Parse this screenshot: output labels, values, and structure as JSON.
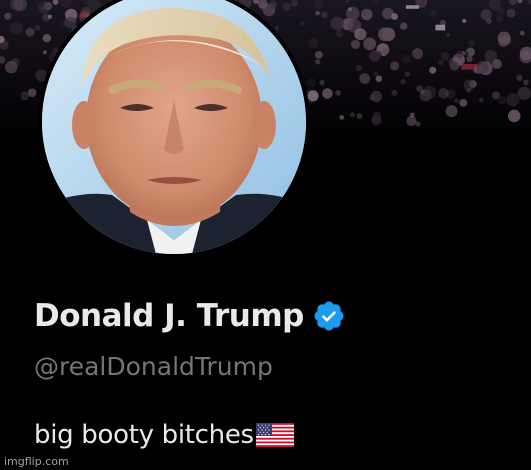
{
  "profile": {
    "display_name": "Donald J. Trump",
    "handle": "@realDonaldTrump",
    "bio": "big booty bitches",
    "verified": true,
    "avatar": "profile-photo",
    "banner": "crowd-photo"
  },
  "icons": {
    "verified": "verified-checkmark-icon",
    "flag": "us-flag-emoji"
  },
  "colors": {
    "background": "#000000",
    "name_text": "#e7e9ea",
    "handle_text": "#71767b",
    "verified_badge": "#1d9bf0"
  },
  "watermark": "imgflip.com"
}
